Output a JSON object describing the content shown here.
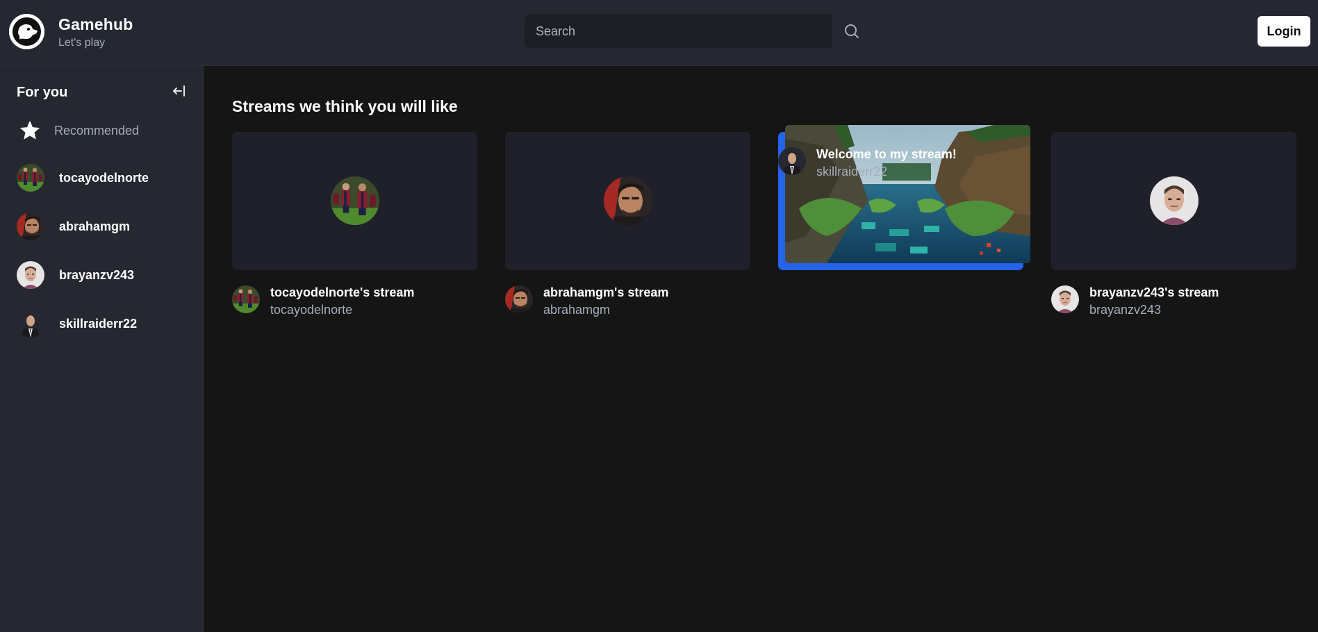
{
  "header": {
    "brand_name": "Gamehub",
    "brand_tagline": "Let's play",
    "search_placeholder": "Search",
    "login_label": "Login",
    "icons": {
      "logo": "gamehub-ghost-logo",
      "search": "search-icon"
    }
  },
  "sidebar": {
    "title": "For you",
    "collapse_icon": "arrow-left-to-line-icon",
    "recommended_label": "Recommended",
    "users": [
      {
        "name": "tocayodelnorte"
      },
      {
        "name": "abrahamgm"
      },
      {
        "name": "brayanzv243"
      },
      {
        "name": "skillraiderr22"
      }
    ]
  },
  "main": {
    "title": "Streams we think you will like",
    "streams": [
      {
        "title": "tocayodelnorte's stream",
        "user": "tocayodelnorte",
        "live": false
      },
      {
        "title": "abrahamgm's stream",
        "user": "abrahamgm",
        "live": false
      },
      {
        "title": "Welcome to my stream!",
        "user": "skillraiderr22",
        "live": true
      },
      {
        "title": "brayanzv243's stream",
        "user": "brayanzv243",
        "live": false
      }
    ]
  },
  "colors": {
    "header_bg": "#252731",
    "sidebar_bg": "#252731",
    "main_bg": "#151515",
    "card_bg": "#1f2029",
    "live_accent": "#2563eb",
    "muted_text": "#a5adbb"
  }
}
